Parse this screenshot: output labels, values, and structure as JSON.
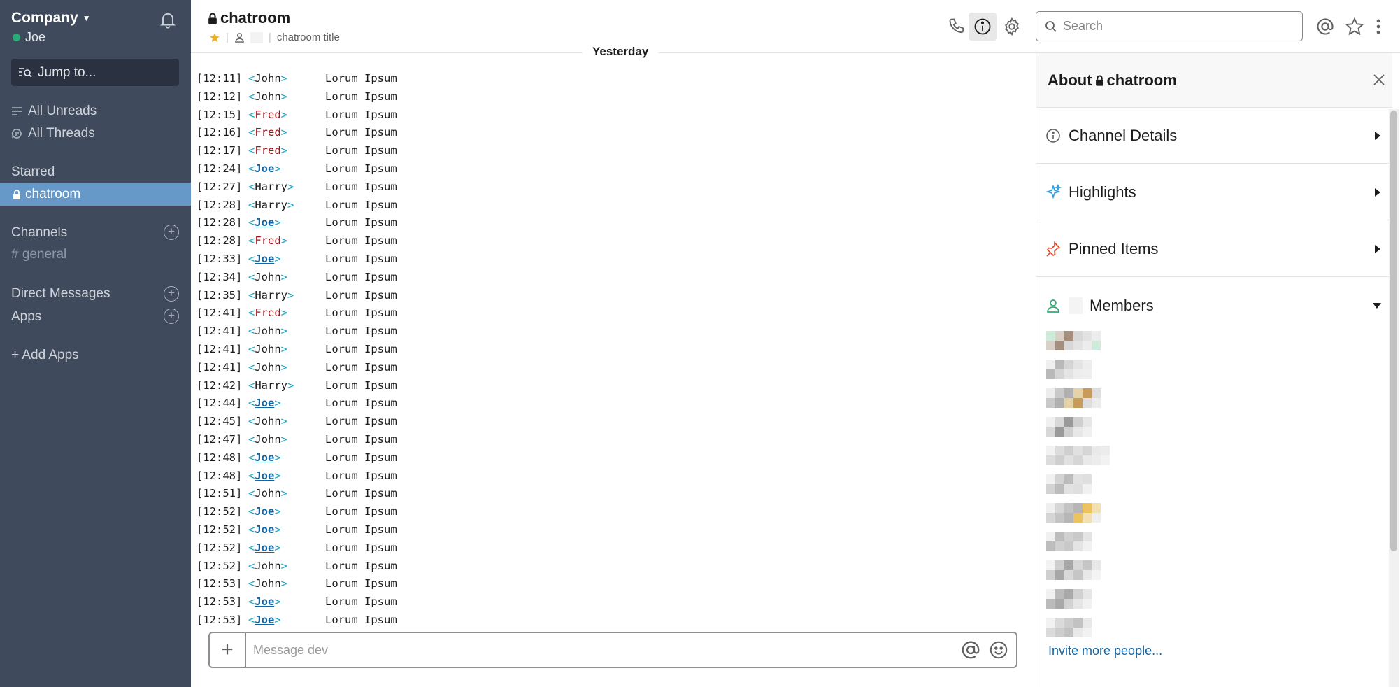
{
  "sidebar": {
    "workspace_name": "Company",
    "user_name": "Joe",
    "jump_to": "Jump to...",
    "all_unreads": "All Unreads",
    "all_threads": "All Threads",
    "starred_label": "Starred",
    "starred_channel": "chatroom",
    "channels_label": "Channels",
    "channel_general": "general",
    "direct_messages_label": "Direct Messages",
    "apps_label": "Apps",
    "add_apps": "+ Add Apps"
  },
  "header": {
    "channel_name": "chatroom",
    "channel_topic": "chatroom title",
    "search_placeholder": "Search"
  },
  "day_divider": "Yesterday",
  "messages": [
    {
      "time": "[12:11]",
      "nick": "John",
      "text": "Lorum Ipsum"
    },
    {
      "time": "[12:12]",
      "nick": "John",
      "text": "Lorum Ipsum"
    },
    {
      "time": "[12:15]",
      "nick": "Fred",
      "text": "Lorum Ipsum"
    },
    {
      "time": "[12:16]",
      "nick": "Fred",
      "text": "Lorum Ipsum"
    },
    {
      "time": "[12:17]",
      "nick": "Fred",
      "text": "Lorum Ipsum"
    },
    {
      "time": "[12:24]",
      "nick": "Joe",
      "text": "Lorum Ipsum"
    },
    {
      "time": "[12:27]",
      "nick": "Harry",
      "text": "Lorum Ipsum"
    },
    {
      "time": "[12:28]",
      "nick": "Harry",
      "text": "Lorum Ipsum"
    },
    {
      "time": "[12:28]",
      "nick": "Joe",
      "text": "Lorum Ipsum"
    },
    {
      "time": "[12:28]",
      "nick": "Fred",
      "text": "Lorum Ipsum"
    },
    {
      "time": "[12:33]",
      "nick": "Joe",
      "text": "Lorum Ipsum"
    },
    {
      "time": "[12:34]",
      "nick": "John",
      "text": "Lorum Ipsum"
    },
    {
      "time": "[12:35]",
      "nick": "Harry",
      "text": "Lorum Ipsum"
    },
    {
      "time": "[12:41]",
      "nick": "Fred",
      "text": "Lorum Ipsum"
    },
    {
      "time": "[12:41]",
      "nick": "John",
      "text": "Lorum Ipsum"
    },
    {
      "time": "[12:41]",
      "nick": "John",
      "text": "Lorum Ipsum"
    },
    {
      "time": "[12:41]",
      "nick": "John",
      "text": "Lorum Ipsum"
    },
    {
      "time": "[12:42]",
      "nick": "Harry",
      "text": "Lorum Ipsum"
    },
    {
      "time": "[12:44]",
      "nick": "Joe",
      "text": "Lorum Ipsum"
    },
    {
      "time": "[12:45]",
      "nick": "John",
      "text": "Lorum Ipsum"
    },
    {
      "time": "[12:47]",
      "nick": "John",
      "text": "Lorum Ipsum"
    },
    {
      "time": "[12:48]",
      "nick": "Joe",
      "text": "Lorum Ipsum"
    },
    {
      "time": "[12:48]",
      "nick": "Joe",
      "text": "Lorum Ipsum"
    },
    {
      "time": "[12:51]",
      "nick": "John",
      "text": "Lorum Ipsum"
    },
    {
      "time": "[12:52]",
      "nick": "Joe",
      "text": "Lorum Ipsum"
    },
    {
      "time": "[12:52]",
      "nick": "Joe",
      "text": "Lorum Ipsum"
    },
    {
      "time": "[12:52]",
      "nick": "Joe",
      "text": "Lorum Ipsum"
    },
    {
      "time": "[12:52]",
      "nick": "John",
      "text": "Lorum Ipsum"
    },
    {
      "time": "[12:53]",
      "nick": "John",
      "text": "Lorum Ipsum"
    },
    {
      "time": "[12:53]",
      "nick": "Joe",
      "text": "Lorum Ipsum"
    },
    {
      "time": "[12:53]",
      "nick": "Joe",
      "text": "Lorum Ipsum"
    }
  ],
  "composer": {
    "placeholder": "Message dev"
  },
  "panel": {
    "title_prefix": "About",
    "title_channel": "chatroom",
    "sections": [
      {
        "label": "Channel Details",
        "icon": "info-icon"
      },
      {
        "label": "Highlights",
        "icon": "sparkle-icon"
      },
      {
        "label": "Pinned Items",
        "icon": "pin-icon"
      },
      {
        "label": "Members",
        "icon": "person-icon"
      }
    ],
    "invite_link": "Invite more people..."
  },
  "colors": {
    "sidebar_bg": "#3f4a5d",
    "active_item": "#6698c8",
    "link_blue": "#1264a3",
    "fred_red": "#a0131a",
    "bracket_teal": "#1ca4c0",
    "presence_green": "#2bac76"
  }
}
